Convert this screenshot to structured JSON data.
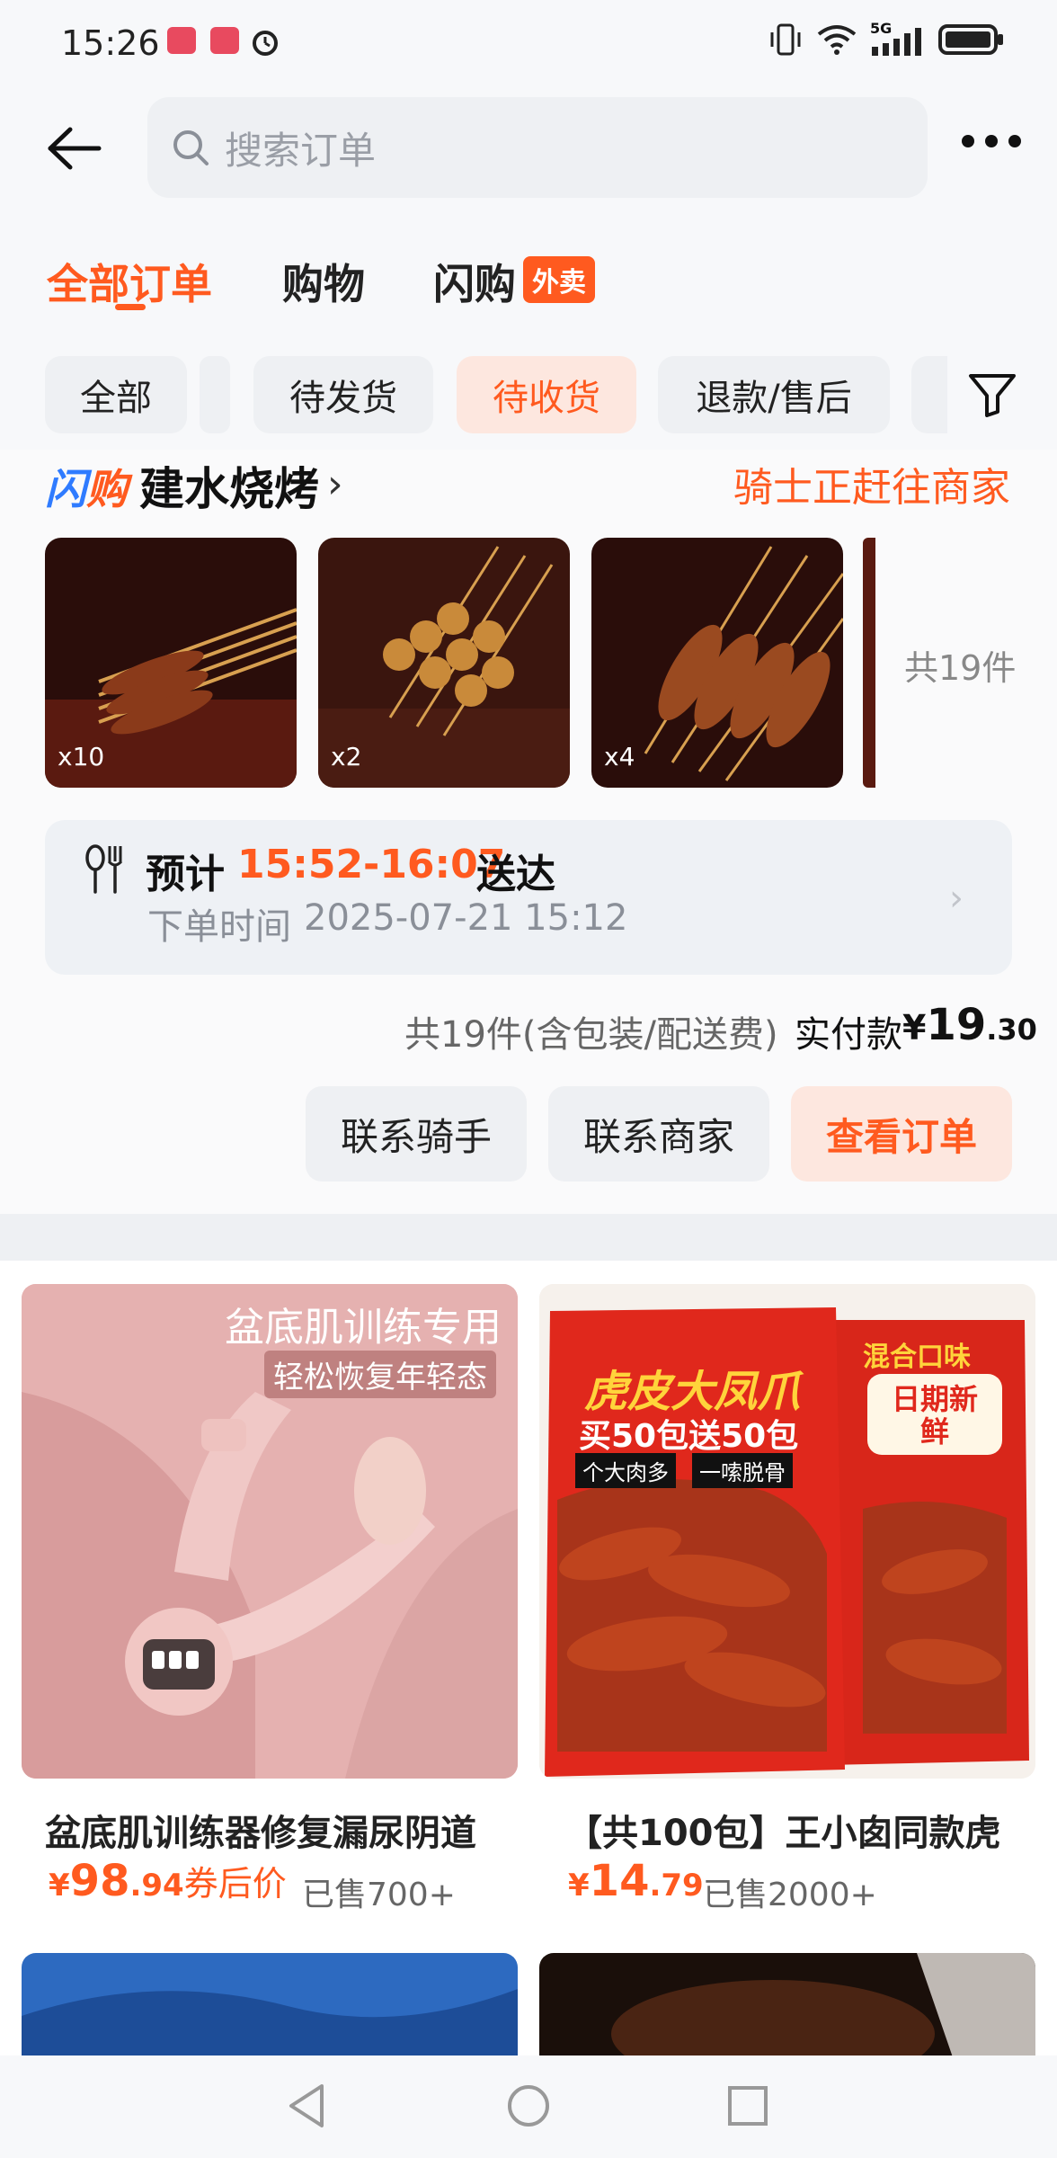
{
  "status_bar": {
    "time": "15:26",
    "network": "5G"
  },
  "search": {
    "placeholder": "搜索订单"
  },
  "main_tabs": [
    {
      "label": "全部订单",
      "active": true
    },
    {
      "label": "购物"
    },
    {
      "label": "闪购",
      "badge": "外卖"
    }
  ],
  "filter_chips": [
    {
      "label": "全部"
    },
    {
      "label": "待发货"
    },
    {
      "label": "待收货",
      "active": true
    },
    {
      "label": "退款/售后"
    }
  ],
  "order": {
    "brand_logo": {
      "part1": "闪",
      "part2": "购"
    },
    "store_name": "建水烧烤",
    "status": "骑士正赶往商家",
    "items": [
      {
        "qty": "x10"
      },
      {
        "qty": "x2"
      },
      {
        "qty": "x4"
      }
    ],
    "total_items": "共19件",
    "eta": {
      "prefix": "预计",
      "time": "15:52-16:07",
      "suffix": "送达"
    },
    "order_time": {
      "label": "下单时间",
      "value": "2025-07-21 15:12"
    },
    "fee_note": "共19件(含包装/配送费)",
    "paid": {
      "label": "实付款",
      "currency": "¥",
      "integer": "19",
      "decimal": ".30"
    },
    "actions": {
      "contact_rider": "联系骑手",
      "contact_merchant": "联系商家",
      "view_order": "查看订单"
    }
  },
  "products": [
    {
      "image_text": {
        "headline": "盆底肌训练专用",
        "sub": "轻松恢复年轻态"
      },
      "title": "盆底肌训练器修复漏尿阴道",
      "price": {
        "currency": "¥",
        "integer": "98",
        "decimal": ".94"
      },
      "coupon_label": "券后价",
      "sold": "已售700+"
    },
    {
      "image_text": {
        "headline": "虎皮大凤爪",
        "promo": "买50包送50包",
        "tag1": "个大肉多",
        "tag2": "一嗦脱骨",
        "flavor": "混合口味",
        "fresh": "日期新鲜"
      },
      "title": "【共100包】王小囱同款虎",
      "price": {
        "currency": "¥",
        "integer": "14",
        "decimal": ".79"
      },
      "sold": "已售2000+"
    }
  ],
  "colors": {
    "accent": "#ff5a1f",
    "chip_bg": "#eef0f3",
    "accent_bg": "#fde7df"
  }
}
